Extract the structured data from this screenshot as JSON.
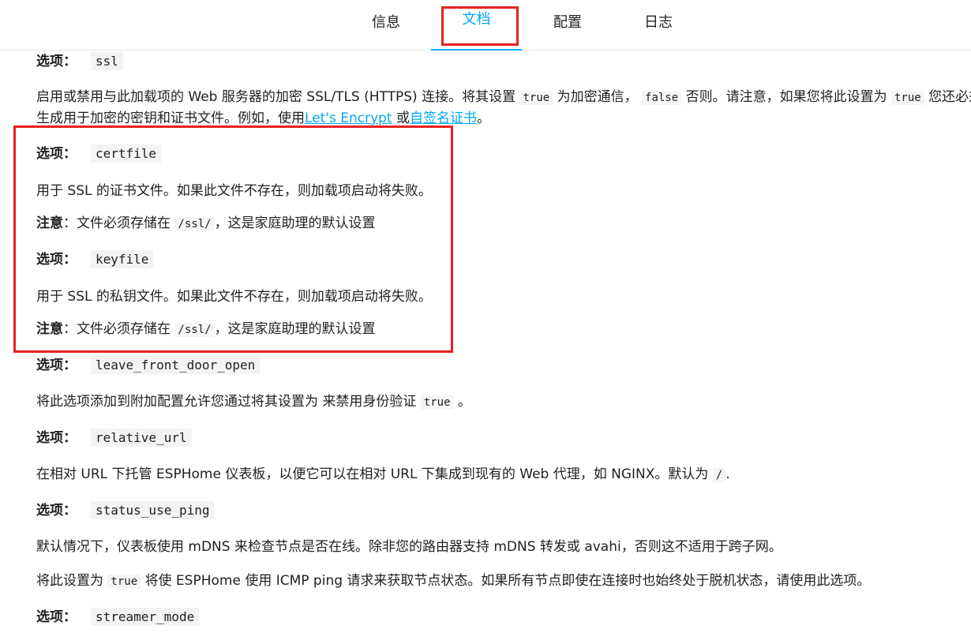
{
  "tabs": [
    {
      "label": "信息"
    },
    {
      "label": "文档"
    },
    {
      "label": "配置"
    },
    {
      "label": "日志"
    }
  ],
  "option_prefix": "选项：",
  "note_prefix": "注意",
  "ssl": {
    "code": "ssl",
    "desc_a": "启用或禁用与此加载项的 Web 服务器的加密 SSL/TLS (HTTPS) 连接。将其设置 ",
    "code_true": "true",
    "desc_b": " 为加密通信， ",
    "code_false": "false",
    "desc_c": " 否则。请注意，如果您将此设置为 ",
    "code_true2": "true",
    "desc_d": " 您还必须",
    "desc_e": "生成用于加密的密钥和证书文件。例如，使用",
    "link_letsencrypt": "Let's Encrypt",
    "desc_f": " 或",
    "link_selfsigned": "自签名证书",
    "desc_g": "。"
  },
  "certfile": {
    "code": "certfile",
    "desc": "用于 SSL 的证书文件。如果此文件不存在，则加载项启动将失败。",
    "note_a": "：文件必须存储在 ",
    "note_code": "/ssl/",
    "note_b": "，这是家庭助理的默认设置"
  },
  "keyfile": {
    "code": "keyfile",
    "desc": "用于 SSL 的私钥文件。如果此文件不存在，则加载项启动将失败。",
    "note_a": "：文件必须存储在 ",
    "note_code": "/ssl/",
    "note_b": "，这是家庭助理的默认设置"
  },
  "leave_front_door_open": {
    "code": "leave_front_door_open",
    "desc_a": "将此选项添加到附加配置允许您通过将其设置为 来禁用身份验证 ",
    "code_true": "true",
    "desc_b": " 。"
  },
  "relative_url": {
    "code": "relative_url",
    "desc_a": "在相对 URL 下托管 ESPHome 仪表板，以便它可以在相对 URL 下集成到现有的 Web 代理，如 NGINX。默认为 ",
    "code_slash": "/",
    "desc_b": "."
  },
  "status_use_ping": {
    "code": "status_use_ping",
    "desc1": "默认情况下，仪表板使用 mDNS 来检查节点是否在线。除非您的路由器支持 mDNS 转发或 avahi，否则这不适用于跨子网。",
    "desc2_a": "将此设置为 ",
    "code_true": "true",
    "desc2_b": " 将使 ESPHome 使用 ICMP ping 请求来获取节点状态。如果所有节点即使在连接时也始终处于脱机状态，请使用此选项。"
  },
  "streamer_mode": {
    "code": "streamer_mode"
  },
  "colors": {
    "accent": "#03a9f4",
    "annotation": "#e8211f"
  }
}
